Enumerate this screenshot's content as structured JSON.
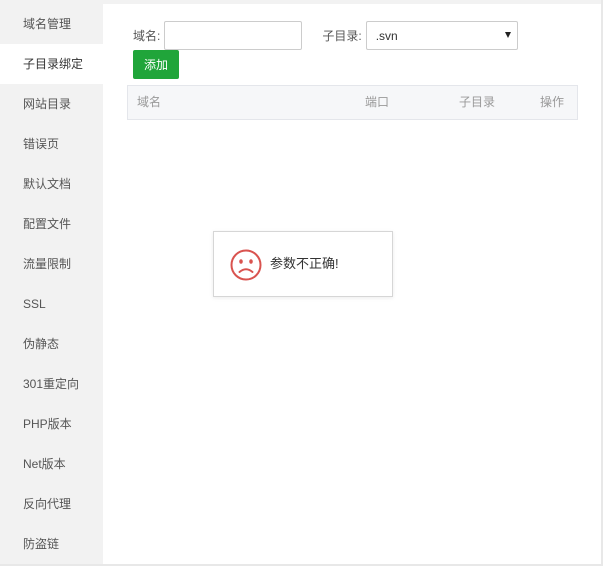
{
  "sidebar": {
    "items": [
      {
        "label": "域名管理"
      },
      {
        "label": "子目录绑定"
      },
      {
        "label": "网站目录"
      },
      {
        "label": "错误页"
      },
      {
        "label": "默认文档"
      },
      {
        "label": "配置文件"
      },
      {
        "label": "流量限制"
      },
      {
        "label": "SSL"
      },
      {
        "label": "伪静态"
      },
      {
        "label": "301重定向"
      },
      {
        "label": "PHP版本"
      },
      {
        "label": "Net版本"
      },
      {
        "label": "反向代理"
      },
      {
        "label": "防盗链"
      }
    ],
    "active_index": 1
  },
  "form": {
    "domain_label": "域名:",
    "domain_value": "",
    "subdir_label": "子目录:",
    "subdir_selected": ".svn",
    "add_label": "添加"
  },
  "table": {
    "headers": {
      "domain": "域名",
      "port": "端口",
      "subdir": "子目录",
      "action": "操作"
    }
  },
  "toast": {
    "message": "参数不正确!",
    "icon": "sad-face-icon",
    "color": "#d9534f"
  },
  "colors": {
    "accent": "#20a53a",
    "sidebar_bg": "#f2f2f2"
  }
}
